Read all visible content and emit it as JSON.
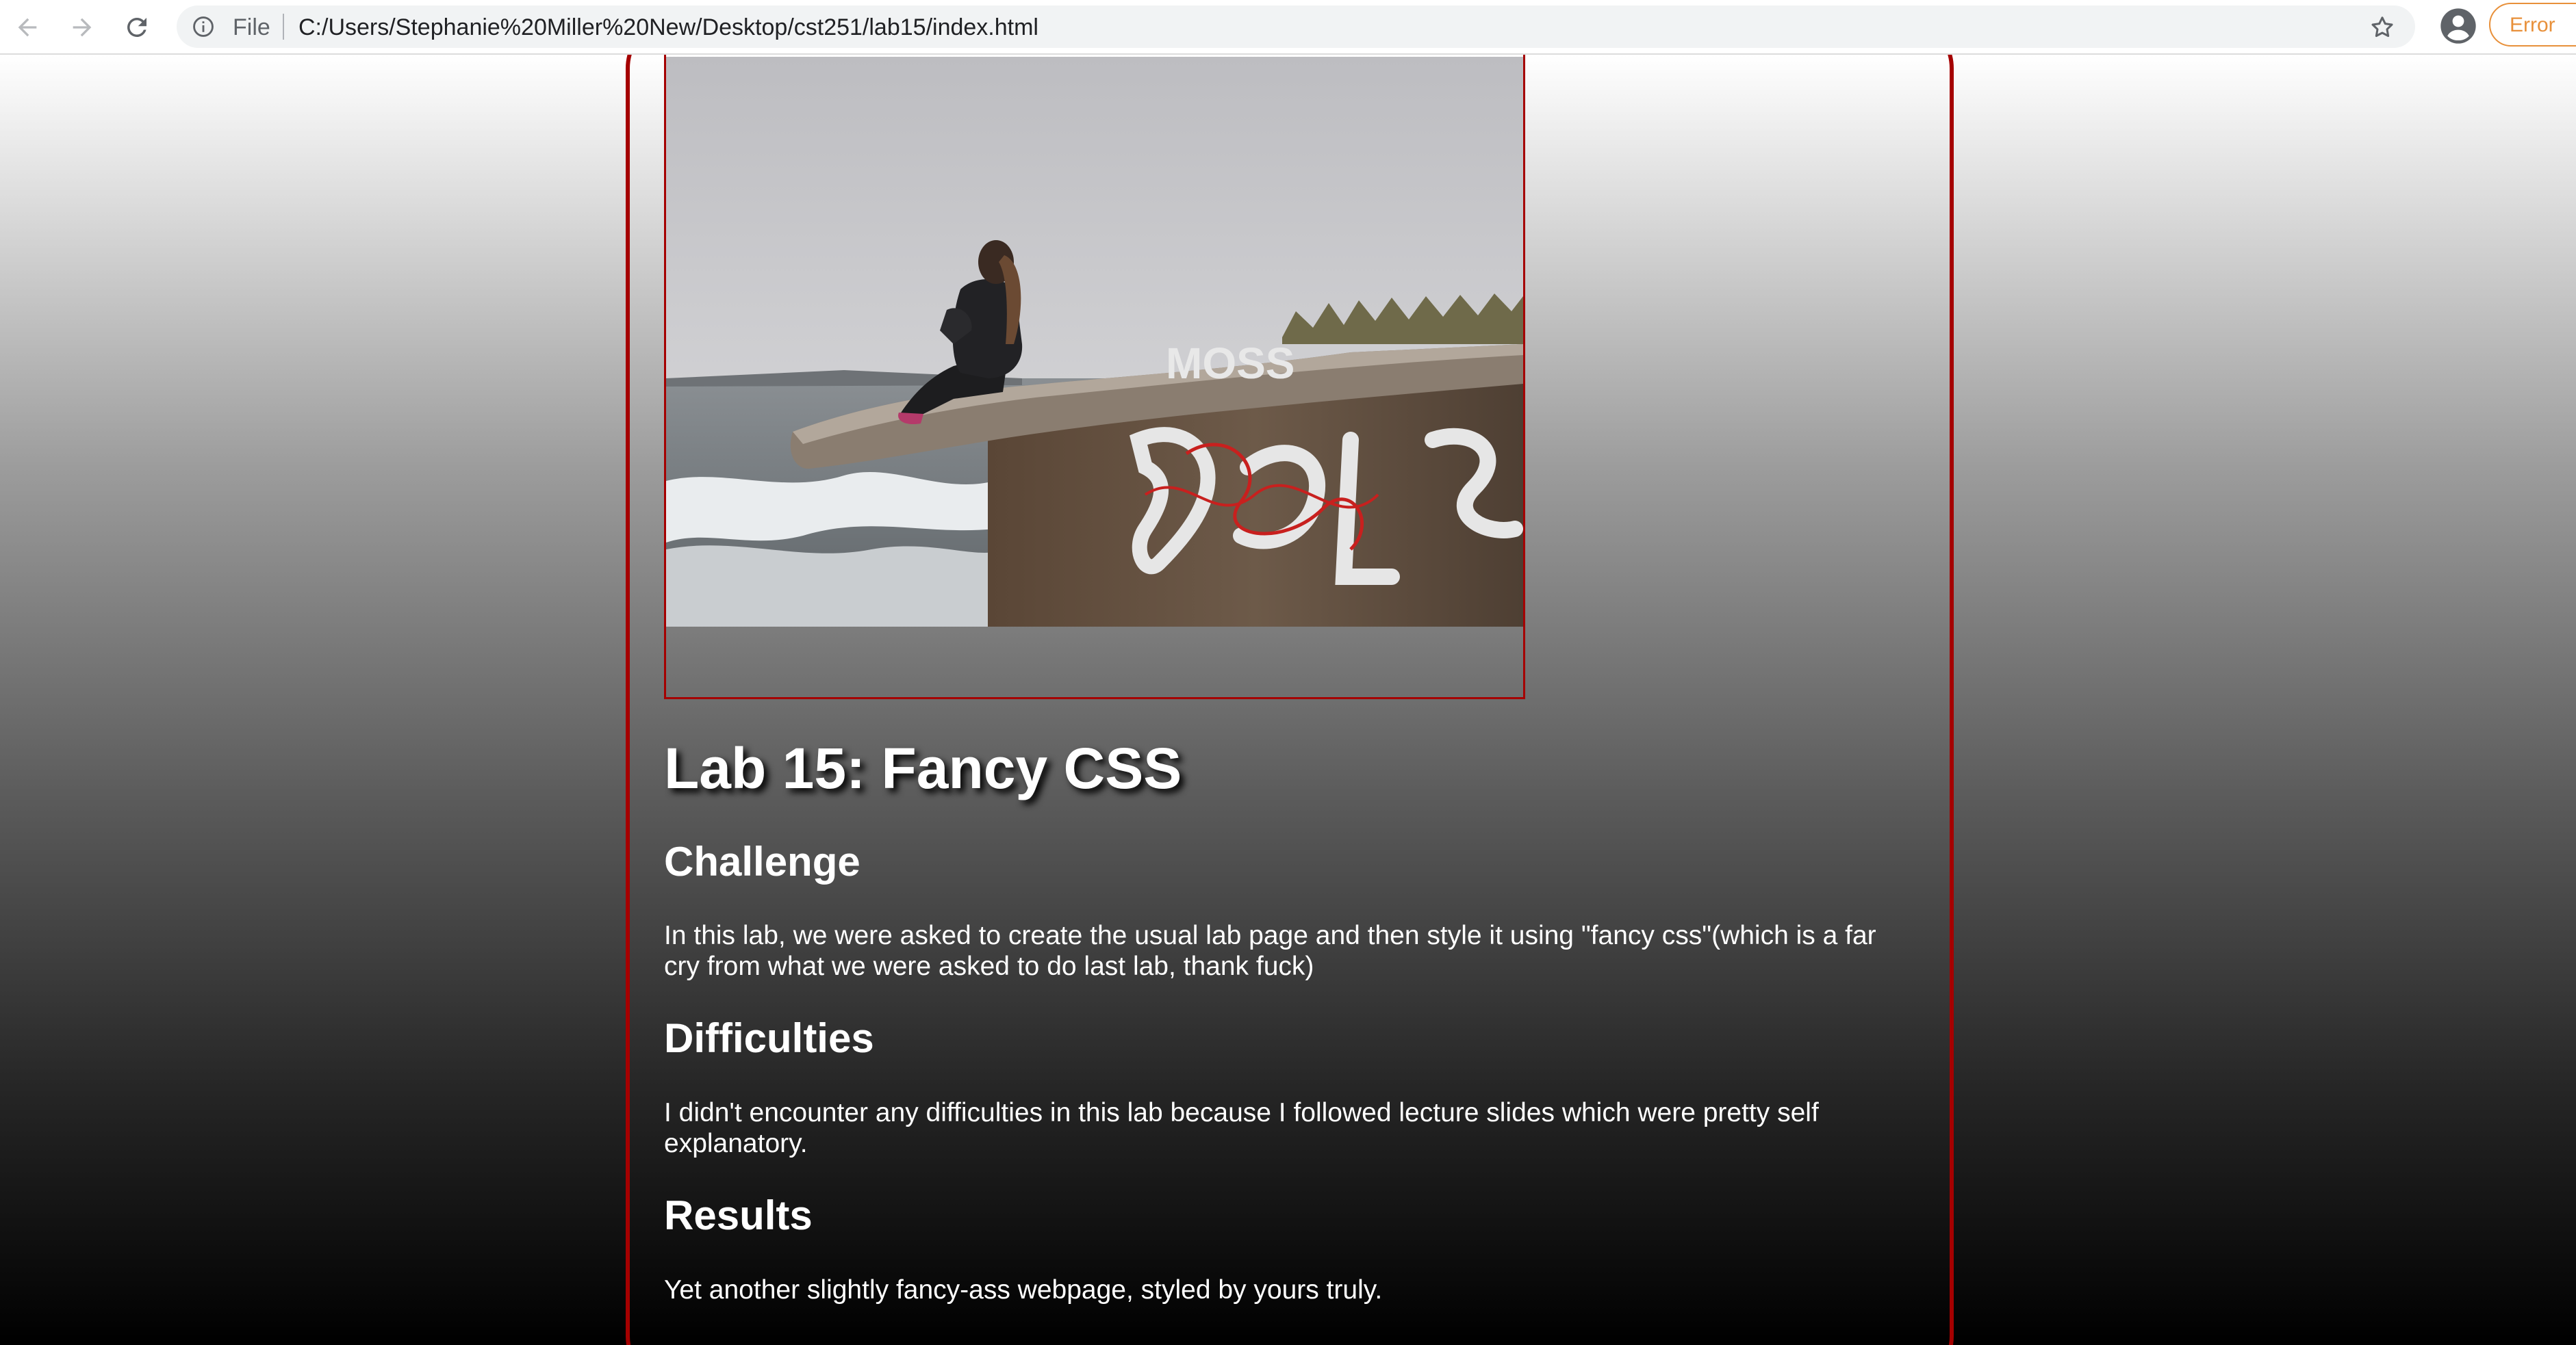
{
  "browser": {
    "file_label": "File",
    "url": "C:/Users/Stephanie%20Miller%20New/Desktop/cst251/lab15/index.html",
    "profile_error_label": "Error",
    "icons": [
      "back-arrow-icon",
      "forward-arrow-icon",
      "reload-icon",
      "info-icon",
      "star-icon",
      "profile-avatar-icon"
    ]
  },
  "page": {
    "image_alt": "Woman sitting on a graffiti-covered concrete ledge overlooking the ocean",
    "graffiti_text": "MOSS",
    "title": "Lab 15: Fancy CSS",
    "sections": [
      {
        "heading": "Challenge",
        "body": "In this lab, we were asked to create the usual lab page and then style it using \"fancy css\"(which is a far cry from what we were asked to do last lab, thank fuck)"
      },
      {
        "heading": "Difficulties",
        "body": "I didn't encounter any difficulties in this lab because I followed lecture slides which were pretty self explanatory."
      },
      {
        "heading": "Results",
        "body": "Yet another slightly fancy-ass webpage, styled by yours truly."
      }
    ]
  },
  "colors": {
    "border_accent": "#a50000",
    "text": "#ffffff",
    "error_chip": "#e8903a"
  }
}
